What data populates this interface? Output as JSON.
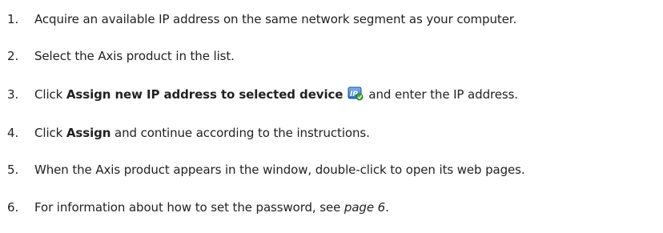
{
  "steps": [
    {
      "number": "1.",
      "text": "Acquire an available IP address on the same network segment as your computer."
    },
    {
      "number": "2.",
      "text": "Select the Axis product in the list."
    },
    {
      "number": "3.",
      "prefix": "Click ",
      "bold": "Assign new IP address to selected device",
      "icon": "assign-ip-icon",
      "suffix": "and enter the IP address."
    },
    {
      "number": "4.",
      "prefix": "Click ",
      "bold": "Assign",
      "suffix": " and continue according to the instructions."
    },
    {
      "number": "5.",
      "text": "When the Axis product appears in the window, double-click to open its web pages."
    },
    {
      "number": "6.",
      "prefix": "For information about how to set the password, see ",
      "link": "page 6",
      "suffix": "."
    }
  ]
}
